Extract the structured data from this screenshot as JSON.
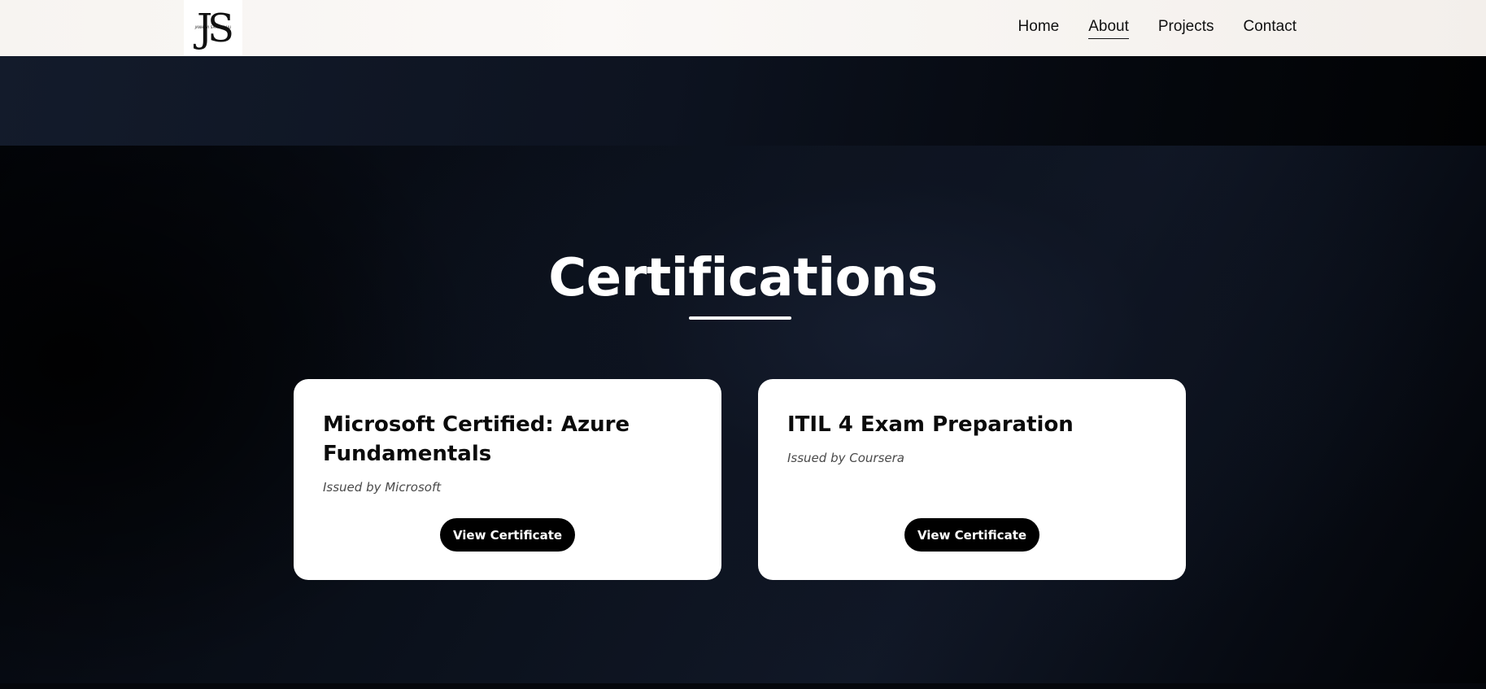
{
  "header": {
    "logo": {
      "mark": "JS",
      "subtitle": "JANHAVI SAMBARAJU"
    },
    "nav": {
      "items": [
        {
          "label": "Home",
          "active": false
        },
        {
          "label": "About",
          "active": true
        },
        {
          "label": "Projects",
          "active": false
        },
        {
          "label": "Contact",
          "active": false
        }
      ]
    }
  },
  "section": {
    "title": "Certifications",
    "cards": [
      {
        "title": "Microsoft Certified: Azure Fundamentals",
        "issuer": "Issued by Microsoft",
        "button_label": "View Certificate"
      },
      {
        "title": "ITIL 4 Exam Preparation",
        "issuer": "Issued by Coursera",
        "button_label": "View Certificate"
      }
    ]
  },
  "colors": {
    "background": "#0b111c",
    "header": "#f7f4f1",
    "card": "#ffffff",
    "button": "#000000",
    "title": "#ffffff"
  }
}
